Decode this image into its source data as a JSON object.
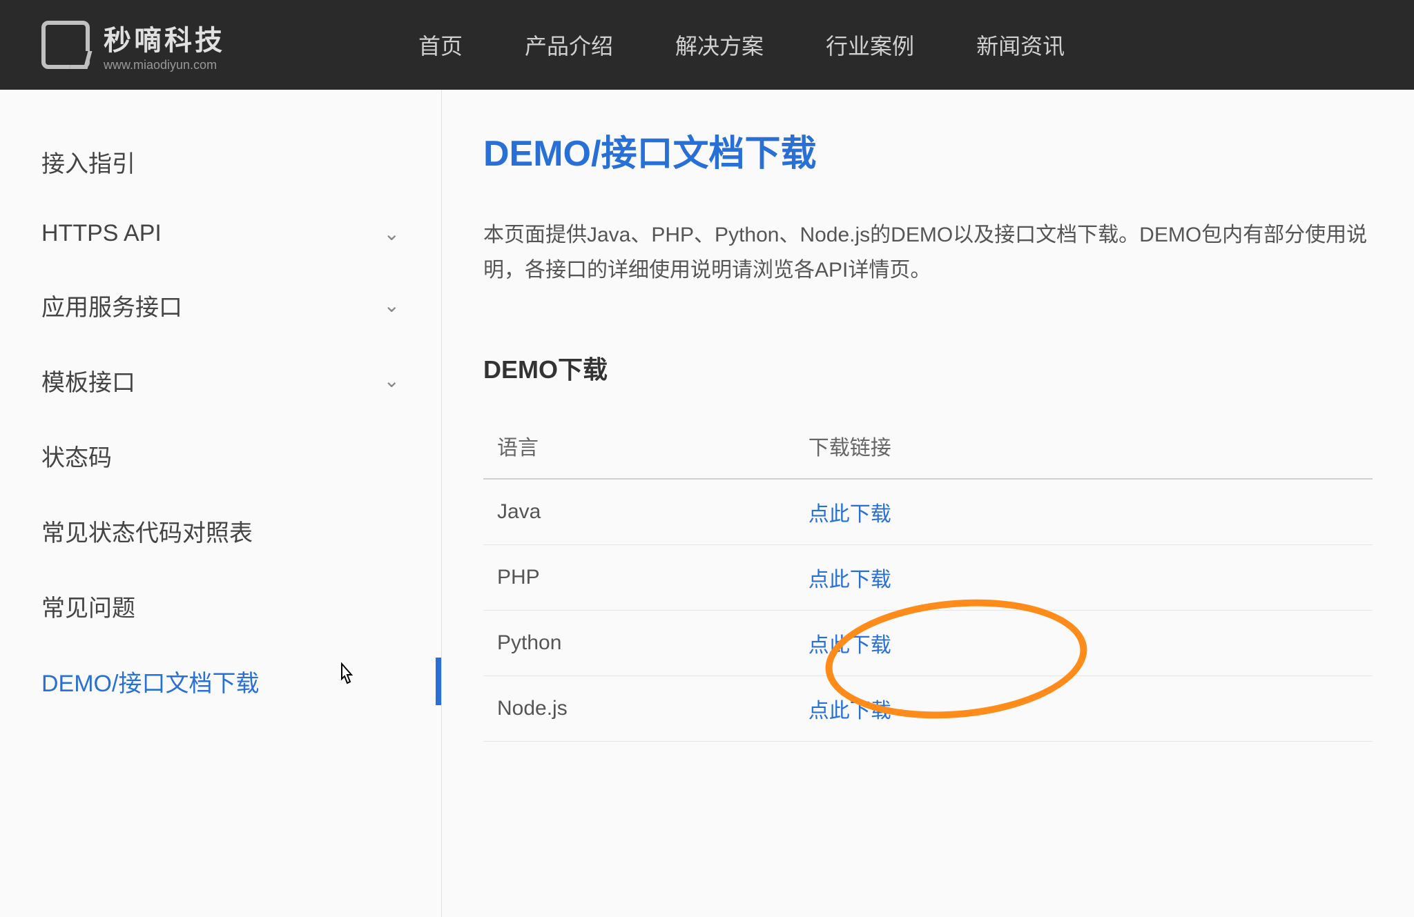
{
  "header": {
    "logo_title": "秒嘀科技",
    "logo_url": "www.miaodiyun.com",
    "nav": [
      "首页",
      "产品介绍",
      "解决方案",
      "行业案例",
      "新闻资讯"
    ]
  },
  "sidebar": {
    "items": [
      {
        "label": "接入指引",
        "expandable": false
      },
      {
        "label": "HTTPS API",
        "expandable": true
      },
      {
        "label": "应用服务接口",
        "expandable": true
      },
      {
        "label": "模板接口",
        "expandable": true
      },
      {
        "label": "状态码",
        "expandable": false
      },
      {
        "label": "常见状态代码对照表",
        "expandable": false
      },
      {
        "label": "常见问题",
        "expandable": false
      },
      {
        "label": "DEMO/接口文档下载",
        "expandable": false,
        "active": true
      }
    ]
  },
  "main": {
    "title": "DEMO/接口文档下载",
    "description": "本页面提供Java、PHP、Python、Node.js的DEMO以及接口文档下载。DEMO包内有部分使用说明，各接口的详细使用说明请浏览各API详情页。",
    "section_title": "DEMO下载",
    "table": {
      "headers": [
        "语言",
        "下载链接"
      ],
      "rows": [
        {
          "language": "Java",
          "link": "点此下载"
        },
        {
          "language": "PHP",
          "link": "点此下载"
        },
        {
          "language": "Python",
          "link": "点此下载"
        },
        {
          "language": "Node.js",
          "link": "点此下载"
        }
      ]
    }
  }
}
